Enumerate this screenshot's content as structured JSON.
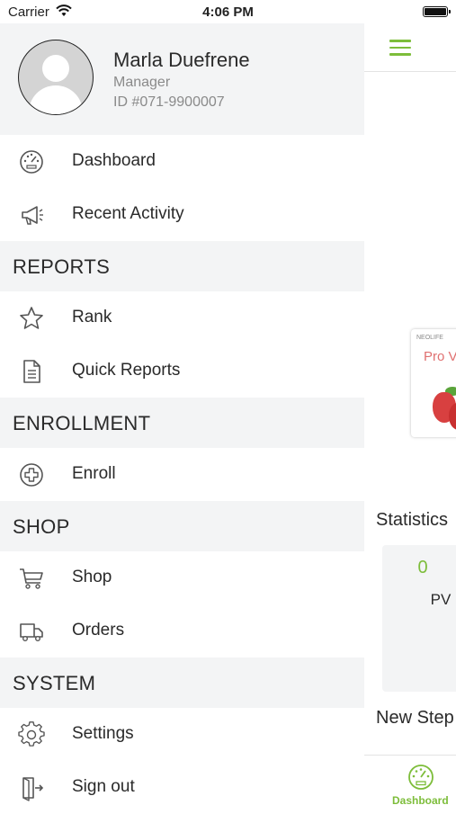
{
  "status_bar": {
    "carrier": "Carrier",
    "time": "4:06 PM"
  },
  "profile": {
    "name": "Marla Duefrene",
    "role": "Manager",
    "id": "ID #071-9900007"
  },
  "menu": {
    "dashboard": "Dashboard",
    "recent_activity": "Recent Activity",
    "reports_header": "REPORTS",
    "rank": "Rank",
    "quick_reports": "Quick Reports",
    "enrollment_header": "ENROLLMENT",
    "enroll": "Enroll",
    "shop_header": "SHOP",
    "shop": "Shop",
    "orders": "Orders",
    "system_header": "SYSTEM",
    "settings": "Settings",
    "sign_out": "Sign out"
  },
  "content": {
    "product_brand": "NEOLIFE",
    "product_name": "Pro Vi",
    "statistics_title": "Statistics",
    "stat_value": "0",
    "stat_label": "PV",
    "new_title": "New Step",
    "tab_dashboard": "Dashboard"
  },
  "colors": {
    "accent": "#7dbd3a",
    "section_bg": "#f3f4f5"
  }
}
